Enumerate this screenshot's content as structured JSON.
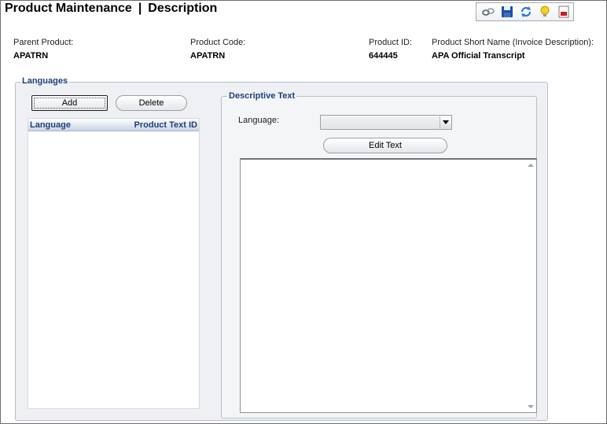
{
  "header": {
    "title": "Product Maintenance",
    "separator": "|",
    "subtitle": "Description"
  },
  "toolbar": {
    "icons": [
      "link-icon",
      "save-icon",
      "refresh-icon",
      "lightbulb-icon",
      "report-icon"
    ]
  },
  "fields": {
    "parent_product": {
      "label": "Parent Product:",
      "value": "APATRN"
    },
    "product_code": {
      "label": "Product Code:",
      "value": "APATRN"
    },
    "product_id": {
      "label": "Product ID:",
      "value": "644445"
    },
    "short_name": {
      "label": "Product Short Name (Invoice Description):",
      "value": "APA Official Transcript"
    }
  },
  "languages": {
    "legend": "Languages",
    "add_label": "Add",
    "delete_label": "Delete",
    "columns": [
      "Language",
      "Product Text ID"
    ],
    "rows": []
  },
  "descriptive_text": {
    "legend": "Descriptive Text",
    "language_label": "Language:",
    "language_value": "",
    "edit_label": "Edit Text",
    "text": ""
  },
  "colors": {
    "legend_blue": "#1f3f7a",
    "group_bg": "#eef0f3"
  }
}
